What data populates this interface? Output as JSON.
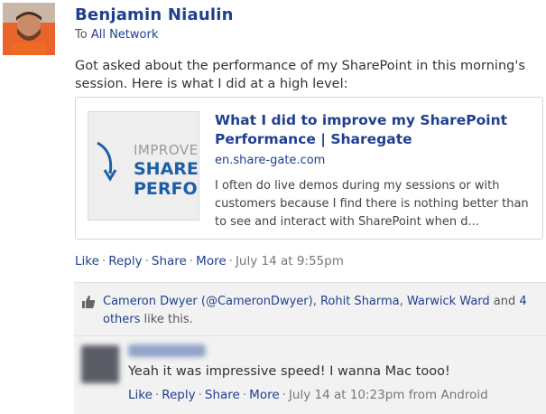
{
  "post": {
    "author": "Benjamin Niaulin",
    "to_label": "To",
    "to_target": "All Network",
    "body": "Got asked about the performance of my SharePoint in this morning's session. Here is what I did at a high level:"
  },
  "link_card": {
    "title": "What I did to improve my SharePoint Performance | Sharegate",
    "domain": "en.share-gate.com",
    "description": "I often do live demos during my sessions or with customers because I find there is nothing better than to see and interact with SharePoint when d...",
    "thumbnail": {
      "line1": "IMPROVE",
      "line2": "SHAREI",
      "line3": "PERFOF"
    }
  },
  "post_actions": {
    "like": "Like",
    "reply": "Reply",
    "share": "Share",
    "more": "More",
    "separator": "·",
    "timestamp": "July 14 at 9:55pm"
  },
  "likes": {
    "icon": "thumbs-up-icon",
    "people": [
      "Cameron Dwyer (@CameronDwyer)",
      "Rohit Sharma",
      "Warwick Ward"
    ],
    "and": "and",
    "others_link": "4 others",
    "suffix": "like this."
  },
  "reply": {
    "author": "",
    "text": "Yeah it was impressive speed! I wanna Mac tooo!",
    "like": "Like",
    "reply": "Reply",
    "share": "Share",
    "more": "More",
    "timestamp": "July 14 at 10:23pm from Android"
  },
  "colors": {
    "link": "#1f3f8f",
    "panel_bg": "#f2f2f2"
  }
}
